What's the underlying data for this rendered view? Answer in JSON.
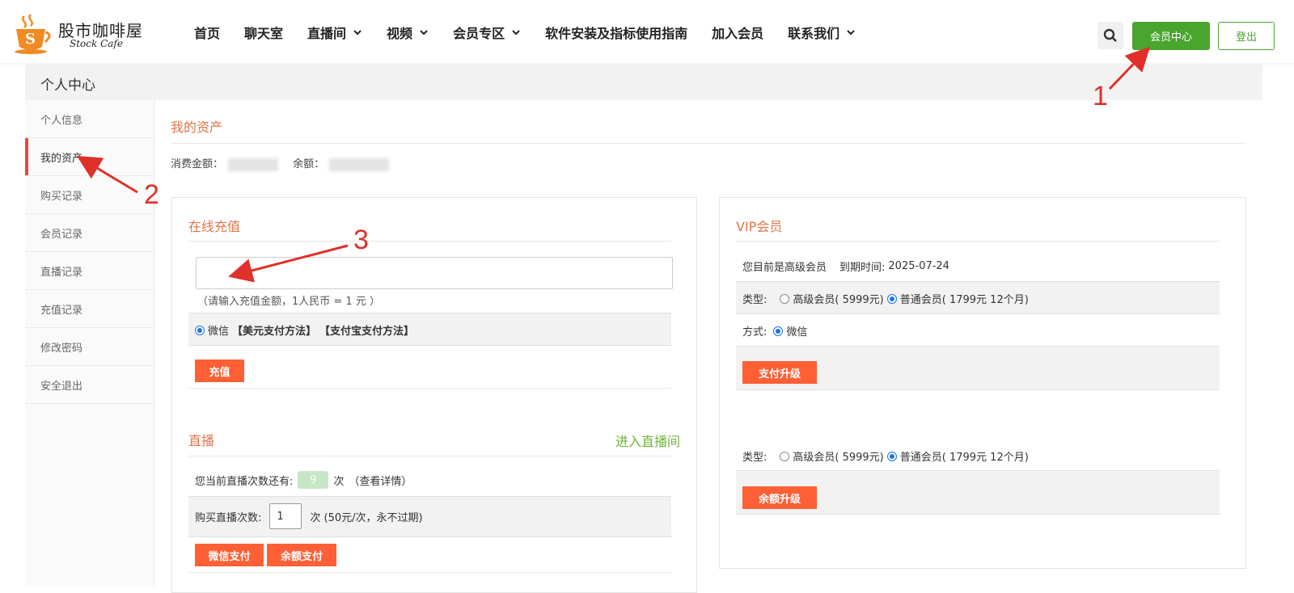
{
  "brand": {
    "name_cn": "股市咖啡屋",
    "name_en": "Stock Cafe",
    "logo_letter": "S",
    "accent_color": "#f08a24"
  },
  "nav": {
    "items": [
      {
        "label": "首页",
        "dropdown": false
      },
      {
        "label": "聊天室",
        "dropdown": false
      },
      {
        "label": "直播间",
        "dropdown": true
      },
      {
        "label": "视频",
        "dropdown": true
      },
      {
        "label": "会员专区",
        "dropdown": true
      },
      {
        "label": "软件安装及指标使用指南",
        "dropdown": false
      },
      {
        "label": "加入会员",
        "dropdown": false
      },
      {
        "label": "联系我们",
        "dropdown": true
      }
    ],
    "search_icon": "search-icon",
    "member_center": "会员中心",
    "logout": "登出",
    "green": "#4aa52e"
  },
  "page_title": "个人中心",
  "sidebar": {
    "items": [
      {
        "label": "个人信息"
      },
      {
        "label": "我的资产"
      },
      {
        "label": "购买记录"
      },
      {
        "label": "会员记录"
      },
      {
        "label": "直播记录"
      },
      {
        "label": "充值记录"
      },
      {
        "label": "修改密码"
      },
      {
        "label": "安全退出"
      }
    ],
    "active_index": 1
  },
  "assets": {
    "title": "我的资产",
    "spent_label": "消费金额：",
    "balance_label": "余额："
  },
  "recharge": {
    "title": "在线充值",
    "amount_value": "",
    "hint": "（请输入充值金额，1人民币 = 1 元 ）",
    "pay_wechat": "微信",
    "pay_usd": "【美元支付方法】",
    "pay_alipay": "【支付宝支付方法】",
    "submit": "充值"
  },
  "live": {
    "title": "直播",
    "enter": "进入直播间",
    "remaining_prefix": "您当前直播次数还有:",
    "remaining_count": "9",
    "remaining_suffix": "次",
    "details": "（查看详情）",
    "buy_label": "购买直播次数:",
    "buy_qty": "1",
    "buy_suffix": "次 (50元/次，永不过期)",
    "wechat_pay": "微信支付",
    "balance_pay": "余额支付"
  },
  "vip": {
    "title": "VIP会员",
    "status": "您目前是高级会员",
    "expire_label": "到期时间:",
    "expire_date": "2025-07-24",
    "type_label": "类型:",
    "opt_senior": "高级会员( 5999元)",
    "opt_normal": "普通会员( 1799元 12个月)",
    "method_label": "方式:",
    "method_wechat": "微信",
    "upgrade_pay": "支付升级",
    "type_label_2": "类型:",
    "opt_senior_2": "高级会员( 5999元)",
    "opt_normal_2": "普通会员( 1799元 12个月)",
    "upgrade_balance": "余额升级"
  },
  "annotations": {
    "one": "1",
    "two": "2",
    "three": "3",
    "color": "#e0302a"
  },
  "colors": {
    "orange_button": "#fe5f35",
    "section_title": "#e0764a",
    "active_marker": "#e04b40"
  }
}
